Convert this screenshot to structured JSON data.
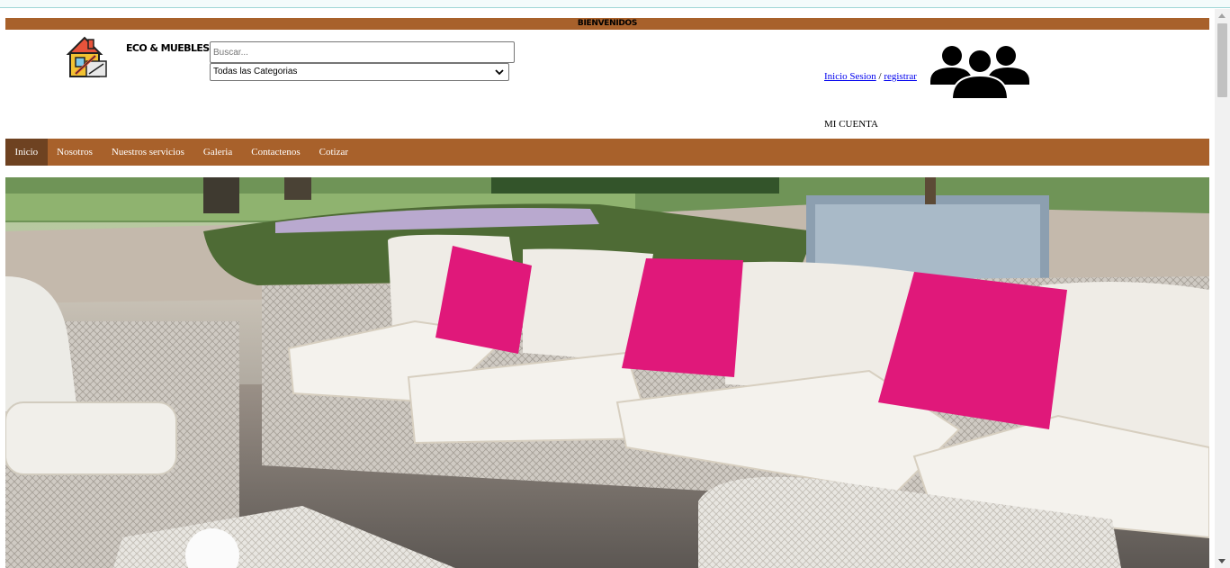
{
  "header": {
    "welcome_text": "BIENVENIDOS",
    "brand_name": "ECO & MUEBLES",
    "logo_icon": "house-tools-icon"
  },
  "search": {
    "placeholder": "Buscar...",
    "value": ""
  },
  "category_select": {
    "selected": "Todas las Categorias",
    "icon": "chevron-down-icon"
  },
  "account": {
    "login_label": "Inicio Sesion",
    "separator": "/",
    "register_label": "registrar",
    "my_account_label": "MI CUENTA",
    "icon": "users-group-icon"
  },
  "nav": {
    "items": [
      {
        "label": "Inicio",
        "active": true
      },
      {
        "label": "Nosotros",
        "active": false
      },
      {
        "label": "Nuestros servicios",
        "active": false
      },
      {
        "label": "Galeria",
        "active": false
      },
      {
        "label": "Contactenos",
        "active": false
      },
      {
        "label": "Cotizar",
        "active": false
      }
    ]
  },
  "colors": {
    "brand_brown": "#a8612b",
    "nav_active": "#6e4221",
    "pillow_pink": "#e0187a"
  }
}
